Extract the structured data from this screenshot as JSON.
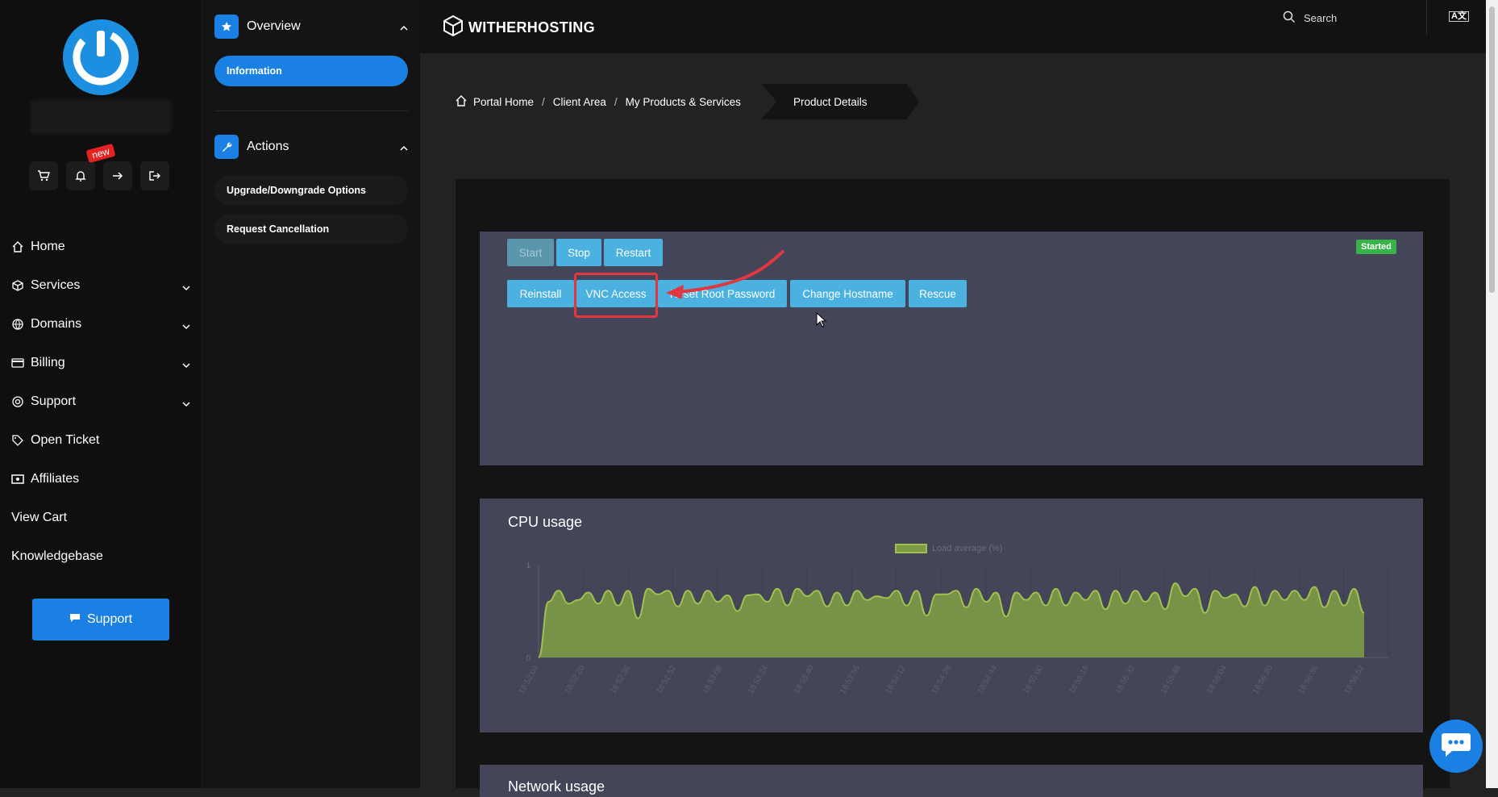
{
  "brand": {
    "name": "WITHERHOSTING"
  },
  "topbar": {
    "search_label": "Search",
    "lang_label": "A文"
  },
  "quick_actions": {
    "badge_new": "new"
  },
  "nav": {
    "items": [
      {
        "label": "Home",
        "icon": "home-icon",
        "has_submenu": false
      },
      {
        "label": "Services",
        "icon": "box-icon",
        "has_submenu": true
      },
      {
        "label": "Domains",
        "icon": "globe-icon",
        "has_submenu": true
      },
      {
        "label": "Billing",
        "icon": "credit-card-icon",
        "has_submenu": true
      },
      {
        "label": "Support",
        "icon": "lifebuoy-icon",
        "has_submenu": true
      },
      {
        "label": "Open Ticket",
        "icon": "tag-icon",
        "has_submenu": false
      },
      {
        "label": "Affiliates",
        "icon": "money-icon",
        "has_submenu": false
      },
      {
        "label": "View Cart",
        "icon": "",
        "has_submenu": false
      },
      {
        "label": "Knowledgebase",
        "icon": "",
        "has_submenu": false
      }
    ],
    "support_button": "Support"
  },
  "subnav": {
    "overview_title": "Overview",
    "overview_items": [
      "Information"
    ],
    "actions_title": "Actions",
    "action_items": [
      "Upgrade/Downgrade Options",
      "Request Cancellation"
    ]
  },
  "breadcrumb": {
    "items": [
      "Portal Home",
      "Client Area",
      "My Products & Services"
    ],
    "active": "Product Details"
  },
  "controls": {
    "row1": [
      "Start",
      "Stop",
      "Restart"
    ],
    "row2": [
      "Reinstall",
      "VNC Access",
      "Reset Root Password",
      "Change Hostname",
      "Rescue"
    ],
    "status": "Started",
    "status_color": "#38b349",
    "accent_color": "#4ab1e0"
  },
  "cpu": {
    "title": "CPU usage"
  },
  "network": {
    "title": "Network usage"
  },
  "chart_data": {
    "type": "area",
    "title": "CPU usage",
    "legend": [
      "Load average (%)"
    ],
    "legend_position": "top",
    "ylim": [
      0,
      1
    ],
    "yticks": [
      "0",
      "1"
    ],
    "categories": [
      "18:52:04",
      "18:52:20",
      "18:52:36",
      "18:52:52",
      "18:53:08",
      "18:53:24",
      "18:53:40",
      "18:53:56",
      "18:54:12",
      "18:54:28",
      "18:54:44",
      "18:55:00",
      "18:55:16",
      "18:55:32",
      "18:55:48",
      "18:56:04",
      "18:56:20",
      "18:56:36",
      "18:56:52"
    ],
    "series": [
      {
        "name": "Load average (%)",
        "values": [
          0,
          0.6,
          0.72,
          0.58,
          0.62,
          0.7,
          0.58,
          0.72,
          0.56,
          0.72,
          0.42,
          0.74,
          0.68,
          0.72,
          0.55,
          0.72,
          0.58,
          0.72,
          0.6,
          0.67,
          0.5,
          0.67,
          0.68,
          0.6,
          0.74,
          0.56,
          0.74,
          0.66,
          0.72,
          0.55,
          0.7,
          0.56,
          0.72,
          0.62,
          0.66,
          0.64,
          0.72,
          0.56,
          0.72,
          0.45,
          0.68,
          0.68,
          0.72,
          0.54,
          0.74,
          0.6,
          0.7,
          0.44,
          0.7,
          0.62,
          0.7,
          0.56,
          0.74,
          0.56,
          0.7,
          0.62,
          0.72,
          0.52,
          0.72,
          0.58,
          0.72,
          0.6,
          0.7,
          0.52,
          0.8,
          0.66,
          0.74,
          0.48,
          0.72,
          0.64,
          0.68,
          0.55,
          0.76,
          0.56,
          0.72,
          0.62,
          0.72,
          0.62,
          0.76,
          0.54,
          0.72,
          0.56,
          0.74,
          0.48
        ]
      }
    ],
    "colors": {
      "fill": "#7e9a45",
      "line": "#a1c14e"
    },
    "grid": true
  }
}
